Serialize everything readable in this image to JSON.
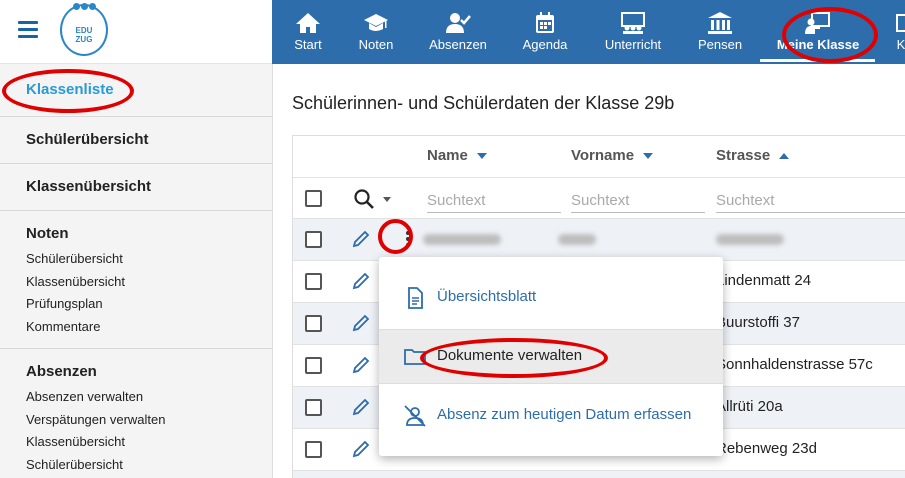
{
  "brand": {
    "logo_line1": "EDU",
    "logo_line2": "ZUG"
  },
  "nav": {
    "items": [
      {
        "label": "Start",
        "icon": "home-icon"
      },
      {
        "label": "Noten",
        "icon": "graduation-cap-icon"
      },
      {
        "label": "Absenzen",
        "icon": "user-check-icon"
      },
      {
        "label": "Agenda",
        "icon": "calendar-icon"
      },
      {
        "label": "Unterricht",
        "icon": "classroom-icon"
      },
      {
        "label": "Pensen",
        "icon": "institution-icon"
      },
      {
        "label": "Meine Klasse",
        "icon": "teacher-board-icon",
        "active": true
      },
      {
        "label": "K",
        "icon": "truncated-icon"
      }
    ]
  },
  "sidebar": {
    "active_link": "Klassenliste",
    "sections": [
      "Schülerübersicht",
      "Klassenübersicht"
    ],
    "noten": {
      "title": "Noten",
      "items": [
        "Schülerübersicht",
        "Klassenübersicht",
        "Prüfungsplan",
        "Kommentare"
      ]
    },
    "absenzen": {
      "title": "Absenzen",
      "items": [
        "Absenzen verwalten",
        "Verspätungen verwalten",
        "Klassenübersicht",
        "Schülerübersicht"
      ]
    }
  },
  "main": {
    "title": "Schülerinnen- und Schülerdaten der Klasse 29b",
    "columns": [
      {
        "label": "Name",
        "sort": "desc"
      },
      {
        "label": "Vorname",
        "sort": "desc"
      },
      {
        "label": "Strasse",
        "sort": "asc"
      }
    ],
    "filter_placeholder": "Suchtext",
    "rows": [
      {
        "strasse": "",
        "blurred": true
      },
      {
        "strasse": "Lindenmatt 24"
      },
      {
        "strasse": "Buurstoffi 37"
      },
      {
        "strasse": "Sonnhaldenstrasse 57c"
      },
      {
        "strasse": "Allrüti 20a"
      },
      {
        "strasse": "Rebenweg 23d"
      }
    ]
  },
  "context_menu": {
    "items": [
      {
        "label": "Übersichtsblatt",
        "icon": "document-icon"
      },
      {
        "label": "Dokumente verwalten",
        "icon": "folder-icon",
        "highlighted": true
      },
      {
        "label": "Absenz zum heutigen Datum erfassen",
        "icon": "user-off-icon"
      }
    ]
  },
  "colors": {
    "nav_bg": "#2d6dab",
    "accent": "#2a9ad6",
    "annotation": "#e00000"
  }
}
